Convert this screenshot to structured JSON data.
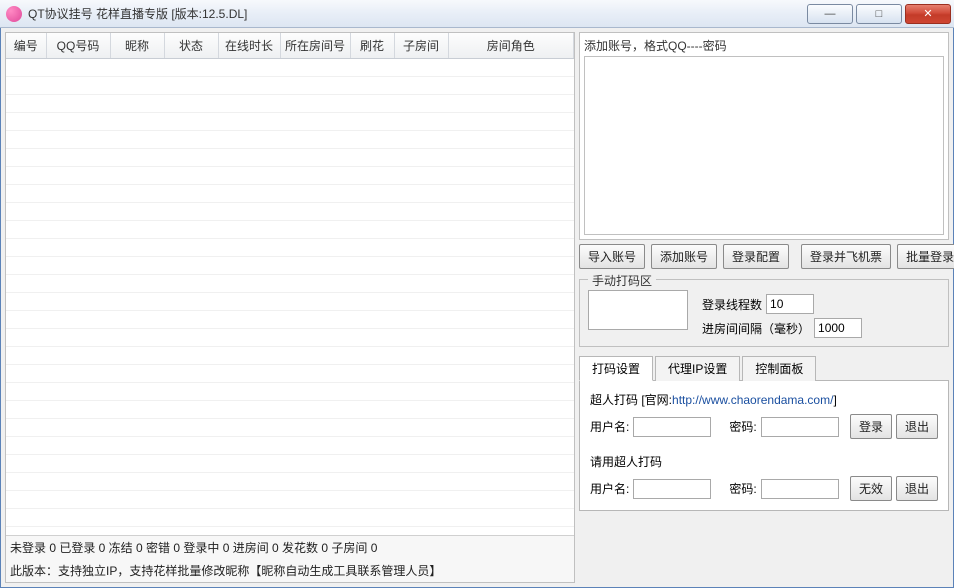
{
  "window": {
    "title": "QT协议挂号 花样直播专版 [版本:12.5.DL]"
  },
  "table": {
    "columns": [
      "编号",
      "QQ号码",
      "昵称",
      "状态",
      "在线时长",
      "所在房间号",
      "刷花",
      "子房间",
      "房间角色"
    ]
  },
  "status_counts": {
    "未登录": 0,
    "已登录": 0,
    "冻结": 0,
    "密错": 0,
    "登录中": 0,
    "进房间": 0,
    "发花数": 0,
    "子房间": 0
  },
  "version_note": "此版本：支持独立IP，支持花样批量修改昵称【昵称自动生成工具联系管理人员】",
  "add_account": {
    "label": "添加账号，格式QQ----密码",
    "value": ""
  },
  "buttons": {
    "import": "导入账号",
    "add": "添加账号",
    "login_cfg": "登录配置",
    "login_fly": "登录并飞机票",
    "batch_login": "批量登录"
  },
  "manual_area": {
    "legend": "手动打码区",
    "threads_label": "登录线程数",
    "threads_value": "10",
    "interval_label": "进房间间隔（毫秒）",
    "interval_value": "1000"
  },
  "tabs": {
    "items": [
      "打码设置",
      "代理IP设置",
      "控制面板"
    ],
    "chaoren": {
      "title_pre": "超人打码 [官网:",
      "url": "http://www.chaorendama.com/",
      "title_post": "]",
      "user_label": "用户名:",
      "pass_label": "密码:",
      "login_btn": "登录",
      "logout_btn": "退出",
      "user_val": "",
      "pass_val": ""
    },
    "chaoren2": {
      "title": "请用超人打码",
      "user_label": "用户名:",
      "pass_label": "密码:",
      "invalid_btn": "无效",
      "logout_btn": "退出",
      "user_val": "",
      "pass_val": ""
    }
  }
}
